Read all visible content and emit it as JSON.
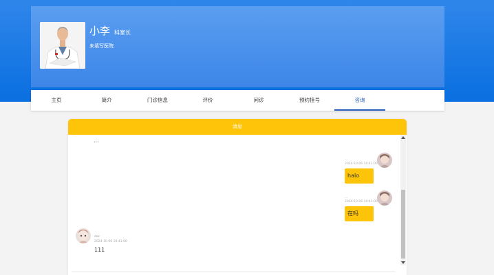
{
  "doctor": {
    "name": "小李",
    "title": "科室长",
    "hospital": "未填写医院",
    "photo_icon": "doctor-photo"
  },
  "nav": {
    "tabs": [
      {
        "label": "主页"
      },
      {
        "label": "简介"
      },
      {
        "label": "门诊信息"
      },
      {
        "label": "评价"
      },
      {
        "label": "问诊"
      },
      {
        "label": "预约挂号"
      },
      {
        "label": "咨询"
      }
    ],
    "active_index": 6
  },
  "chat": {
    "header": "消息",
    "ellipsis": "...",
    "messages": [
      {
        "sender": "...",
        "time": "2024-10-06 10:41:00",
        "text": "halo",
        "direction": "sent"
      },
      {
        "sender": "...",
        "time": "2024-10-06 10:41:00",
        "text": "在吗",
        "direction": "sent"
      },
      {
        "sender": "doc",
        "time": "2024-10-06 10:41:00",
        "text": "111",
        "direction": "received"
      }
    ]
  },
  "colors": {
    "header_blue": "#0a6fe0",
    "accent_yellow": "#fec409",
    "active_tab": "#2c5fc0"
  }
}
